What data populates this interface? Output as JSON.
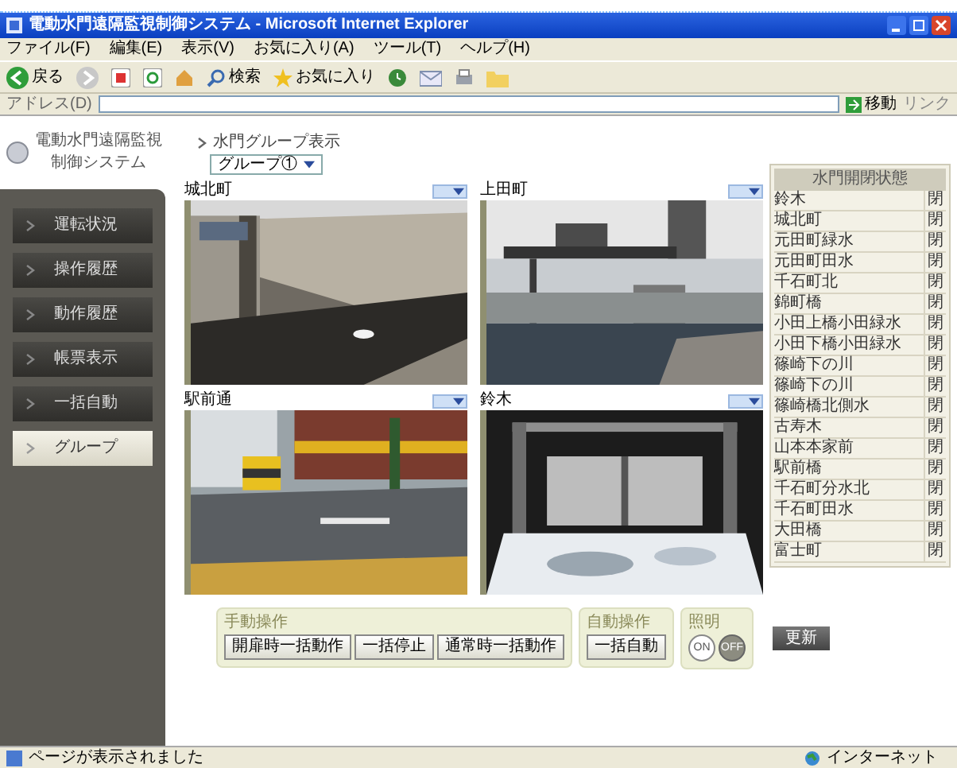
{
  "window": {
    "title": "電動水門遠隔監視制御システム - Microsoft Internet Explorer"
  },
  "menu": [
    "ファイル(F)",
    "編集(E)",
    "表示(V)",
    "お気に入り(A)",
    "ツール(T)",
    "ヘルプ(H)"
  ],
  "toolbar": {
    "back": "戻る",
    "search": "検索",
    "favorites": "お気に入り"
  },
  "address": {
    "label": "アドレス(D)",
    "go": "移動",
    "links": "リンク"
  },
  "logo": {
    "lines": [
      "電動水門遠隔監視",
      "制御システム"
    ]
  },
  "nav": [
    {
      "label": "運転状況",
      "selected": false
    },
    {
      "label": "操作履歴",
      "selected": false
    },
    {
      "label": "動作履歴",
      "selected": false
    },
    {
      "label": "帳票表示",
      "selected": false
    },
    {
      "label": "一括自動",
      "selected": false
    },
    {
      "label": "グループ",
      "selected": true
    }
  ],
  "group_view": {
    "title": "水門グループ表示",
    "value": "グループ①"
  },
  "cameras": [
    {
      "name": "城北町",
      "kind": "gate"
    },
    {
      "name": "上田町",
      "kind": "bridge"
    },
    {
      "name": "駅前通",
      "kind": "street"
    },
    {
      "name": "鈴木",
      "kind": "flow"
    }
  ],
  "gate_list": {
    "title": "水門開閉状態",
    "rows": [
      {
        "name": "鈴木",
        "status": "閉"
      },
      {
        "name": "城北町",
        "status": "閉"
      },
      {
        "name": "元田町緑水",
        "status": "閉"
      },
      {
        "name": "元田町田水",
        "status": "閉"
      },
      {
        "name": "千石町北",
        "status": "閉"
      },
      {
        "name": "錦町橋",
        "status": "閉"
      },
      {
        "name": "小田上橋小田緑水",
        "status": "閉"
      },
      {
        "name": "小田下橋小田緑水",
        "status": "閉"
      },
      {
        "name": "篠崎下の川",
        "status": "閉"
      },
      {
        "name": "篠崎下の川",
        "status": "閉"
      },
      {
        "name": "篠崎橋北側水",
        "status": "閉"
      },
      {
        "name": "古寿木",
        "status": "閉"
      },
      {
        "name": "山本本家前",
        "status": "閉"
      },
      {
        "name": "駅前橋",
        "status": "閉"
      },
      {
        "name": "千石町分水北",
        "status": "閉"
      },
      {
        "name": "千石町田水",
        "status": "閉"
      },
      {
        "name": "大田橋",
        "status": "閉"
      },
      {
        "name": "富士町",
        "status": "閉"
      }
    ]
  },
  "controls": {
    "manual": {
      "title": "手動操作",
      "buttons": [
        "開扉時一括動作",
        "一括停止",
        "通常時一括動作"
      ]
    },
    "auto": {
      "title": "自動操作",
      "buttons": [
        "一括自動"
      ]
    },
    "light": {
      "title": "照明",
      "options": [
        {
          "label": "ON",
          "selected": false
        },
        {
          "label": "OFF",
          "selected": true
        }
      ]
    },
    "refresh": "更新"
  },
  "status_bar": {
    "text": "ページが表示されました",
    "zone": "インターネット"
  }
}
